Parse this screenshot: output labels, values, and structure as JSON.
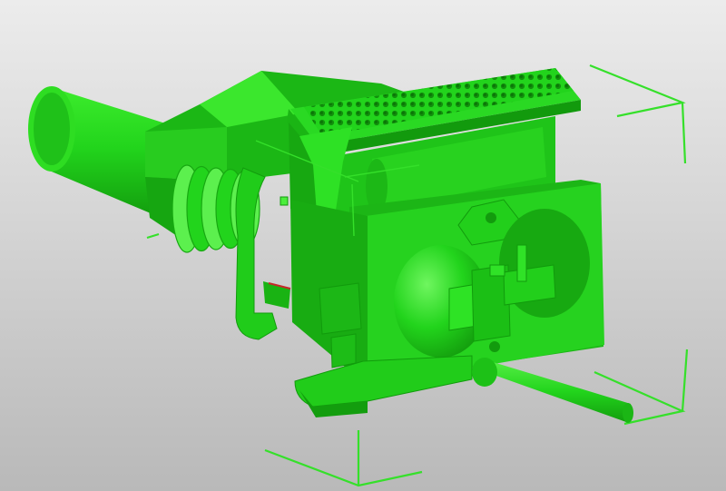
{
  "viewport": {
    "background_top": "#ececec",
    "background_bottom": "#b9b9b9",
    "model_color": "#22d41c",
    "model_shade": "#17a811",
    "model_highlight": "#5cf04e",
    "bounding_box_color": "#35e02a",
    "marker_color": "#c62828"
  },
  "model": {
    "kind": "3d-assembly",
    "parts": [
      "cylinder-tube",
      "hopper-funnel",
      "ribbed-coupling",
      "perforated-grate",
      "mounting-plate",
      "spherical-dome",
      "handle-rod",
      "base-foot"
    ]
  },
  "bounding_box": {
    "visible": true,
    "corners": [
      "top-right",
      "bottom-right",
      "bottom-left",
      "left"
    ]
  }
}
